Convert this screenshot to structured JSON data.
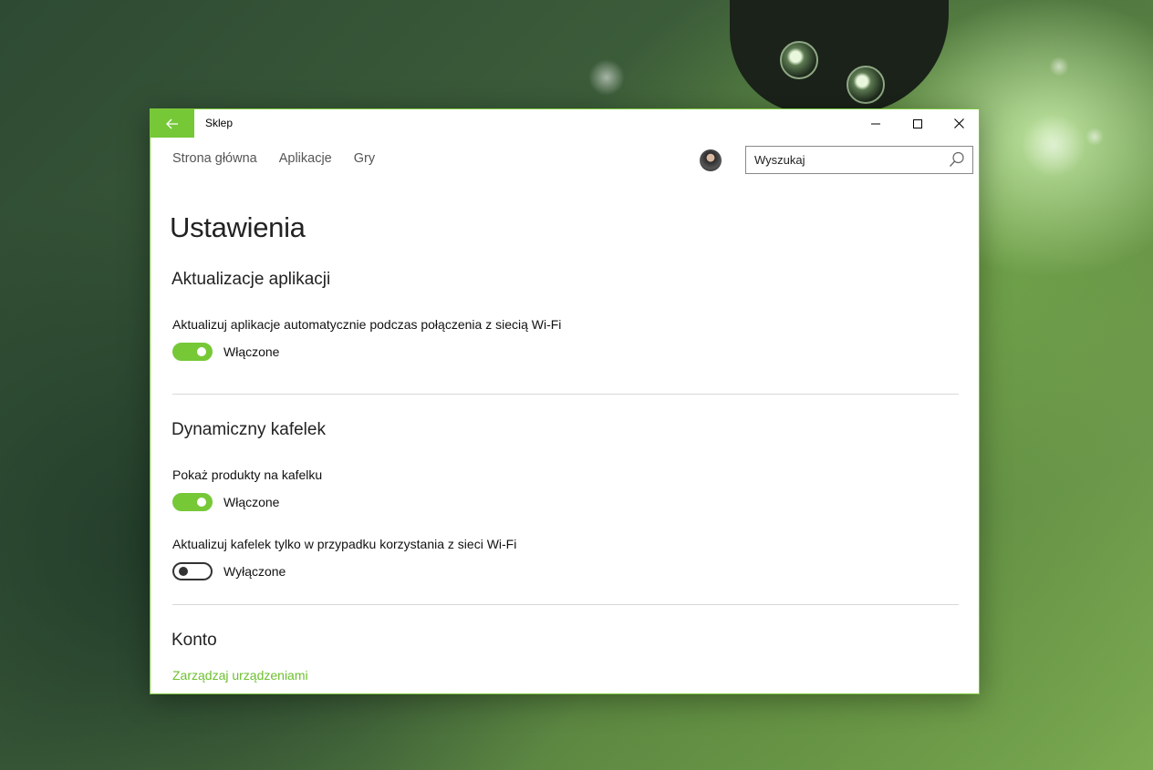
{
  "window": {
    "title": "Sklep",
    "accent_color": "#76c837"
  },
  "titlebar": {
    "back_icon": "arrow-left-icon",
    "minimize_icon": "minimize-icon",
    "maximize_icon": "maximize-icon",
    "close_icon": "close-icon"
  },
  "nav": {
    "items": [
      {
        "label": "Strona główna"
      },
      {
        "label": "Aplikacje"
      },
      {
        "label": "Gry"
      }
    ]
  },
  "search": {
    "value": "Wyszukaj",
    "icon": "search-icon"
  },
  "page": {
    "title": "Ustawienia"
  },
  "sections": {
    "app_updates": {
      "title": "Aktualizacje aplikacji",
      "settings": [
        {
          "label": "Aktualizuj aplikacje automatycznie podczas połączenia z siecią Wi-Fi",
          "state_label": "Włączone",
          "on": true
        }
      ]
    },
    "live_tile": {
      "title": "Dynamiczny kafelek",
      "settings": [
        {
          "label": "Pokaż produkty na kafelku",
          "state_label": "Włączone",
          "on": true
        },
        {
          "label": "Aktualizuj kafelek tylko w przypadku korzystania z sieci Wi-Fi",
          "state_label": "Wyłączone",
          "on": false
        }
      ]
    },
    "account": {
      "title": "Konto",
      "link": "Zarządzaj urządzeniami"
    }
  }
}
